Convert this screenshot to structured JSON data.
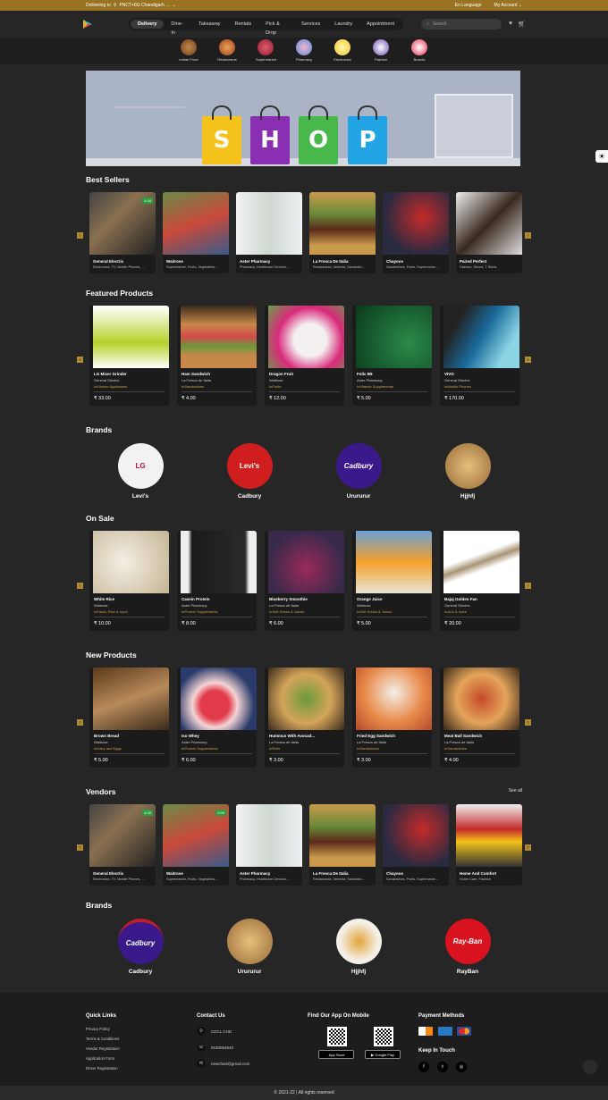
{
  "topbar": {
    "delivering": "Delivering to",
    "location": "PNCT+8G Chandigarh ...",
    "language": "Language",
    "account": "My Account"
  },
  "nav": {
    "tabs": [
      "Delivery",
      "Dine-In",
      "Takeaway",
      "Rentals",
      "Pick & Drop",
      "Services",
      "Laundry",
      "Appointment"
    ],
    "search_placeholder": "Search"
  },
  "categories": [
    "Indian Food",
    "Restaurants",
    "Supermarket",
    "Pharmacy",
    "Electronics",
    "Fashion",
    "Brands"
  ],
  "banner": {
    "letters": [
      "S",
      "H",
      "O",
      "P"
    ]
  },
  "best_sellers": {
    "title": "Best Sellers",
    "items": [
      {
        "name": "General Electric",
        "sub": "Electronics, TV, Mobile Phones, ...",
        "badge": "4.04"
      },
      {
        "name": "Waitrose",
        "sub": "Supermarket, Fruits, Vegetables...",
        "badge": ""
      },
      {
        "name": "Aster Pharmacy",
        "sub": "Pharmacy, Healthcare Devices, ...",
        "badge": ""
      },
      {
        "name": "La Fresca De Italia",
        "sub": "Restaurants, Venezia, Sandwich...",
        "badge": ""
      },
      {
        "name": "Chayoos",
        "sub": "Sandwiches, Fruits, Supermarke...",
        "badge": ""
      },
      {
        "name": "Paired Perfect",
        "sub": "Fashion, Shoes, T Shirts",
        "badge": ""
      }
    ]
  },
  "featured": {
    "title": "Featured Products",
    "items": [
      {
        "name": "LG Mixer Grinder",
        "store": "General Electric",
        "cat": "InKitchen Appliances",
        "price": "₹ 33.00"
      },
      {
        "name": "Ham Sandwich",
        "store": "La Fresca de Italia",
        "cat": "InSandwiches",
        "price": "₹ 4.00"
      },
      {
        "name": "Dragon Fruit",
        "store": "Waitrose",
        "cat": "InFruits",
        "price": "₹ 12.00"
      },
      {
        "name": "Folic B9",
        "store": "Aster Pharmacy",
        "cat": "InVitamin Supplements",
        "price": "₹ 5.00"
      },
      {
        "name": "VIVO",
        "store": "General Electric",
        "cat": "InMobile Phones",
        "price": "₹ 170.00"
      }
    ]
  },
  "brands1": {
    "title": "Brands",
    "items": [
      {
        "name": "Levi's",
        "logo": "LG"
      },
      {
        "name": "Cadbury",
        "logo": "Levi's"
      },
      {
        "name": "Urururur",
        "logo": "Cadbury"
      },
      {
        "name": "Hjjhfj",
        "logo": ""
      }
    ]
  },
  "on_sale": {
    "title": "On Sale",
    "items": [
      {
        "name": "White Rice",
        "store": "Waitrose",
        "cat": "InPasta, Rice & more",
        "price": "₹ 10.00"
      },
      {
        "name": "Casein Protein",
        "store": "Aster Pharmacy",
        "cat": "InProtein Supplements",
        "price": "₹ 8.00"
      },
      {
        "name": "Blueberry Smoothie",
        "store": "La Fresca de Italia",
        "cat": "InSoft Drinks & Juices",
        "price": "₹ 6.00"
      },
      {
        "name": "Orange Juice",
        "store": "Waitrose",
        "cat": "InSoft Drinks & Juices",
        "price": "₹ 5.00"
      },
      {
        "name": "Bajaj Golden Fan",
        "store": "General Electric",
        "cat": "InACs & more",
        "price": "₹ 20.00"
      }
    ]
  },
  "new_products": {
    "title": "New Products",
    "items": [
      {
        "name": "Brown Bread",
        "store": "Waitrose",
        "cat": "InDairy and Eggs",
        "price": "₹ 5.00"
      },
      {
        "name": "Iso Whey",
        "store": "Aster Pharmacy",
        "cat": "InProtein Supplements",
        "price": "₹ 6.00"
      },
      {
        "name": "Hummus With Avocad...",
        "store": "La Fresca de Italia",
        "cat": "InRolls",
        "price": "₹ 3.00"
      },
      {
        "name": "Fried Egg Sandwich",
        "store": "La Fresca de Italia",
        "cat": "InSandwiches",
        "price": "₹ 3.00"
      },
      {
        "name": "Meat Ball Sandwich",
        "store": "La Fresca de Italia",
        "cat": "InSandwiches",
        "price": "₹ 4.00"
      }
    ]
  },
  "vendors": {
    "title": "Vendors",
    "see_all": "See all",
    "items": [
      {
        "name": "General Electric",
        "sub": "Electronics, TV, Mobile Phones, ...",
        "badge": "4.00"
      },
      {
        "name": "Waitrose",
        "sub": "Supermarket, Fruits, Vegetables...",
        "badge": "0.00"
      },
      {
        "name": "Aster Pharmacy",
        "sub": "Pharmacy, Healthcare Devices, ...",
        "badge": ""
      },
      {
        "name": "La Fresca De Italia",
        "sub": "Restaurants, Venezia, Sandwich...",
        "badge": ""
      },
      {
        "name": "Chayoos",
        "sub": "Sandwiches, Fruits, Supermarke...",
        "badge": ""
      },
      {
        "name": "Home And Comfort",
        "sub": "Home Care, Fashion",
        "badge": ""
      }
    ]
  },
  "brands2": {
    "title": "Brands",
    "items": [
      {
        "name": "Cadbury",
        "logo": "Cadbury"
      },
      {
        "name": "Urururur",
        "logo": ""
      },
      {
        "name": "Hjjhfj",
        "logo": ""
      },
      {
        "name": "RayBan",
        "logo": "Ray-Ban"
      }
    ]
  },
  "footer": {
    "quick_links_title": "Quick Links",
    "quick_links": [
      "Privacy Policy",
      "Terms & Conditions",
      "Vendor Registration",
      "Application Form",
      "Driver Registration"
    ],
    "contact_title": "Contact Us",
    "contact": [
      "CDCL CHD",
      "9150054840",
      "newchart@gmail.com"
    ],
    "app_title": "Find Our App On Mobile",
    "app_store": "App Store",
    "google_play": "Google Play",
    "payment_title": "Payment Methods",
    "keep_title": "Keep In Touch",
    "copyright": "© 2021-22 | All rights reserved"
  },
  "colors": {
    "accent": "#9a7322",
    "bg": "#262626",
    "card": "#1b1b1b"
  }
}
